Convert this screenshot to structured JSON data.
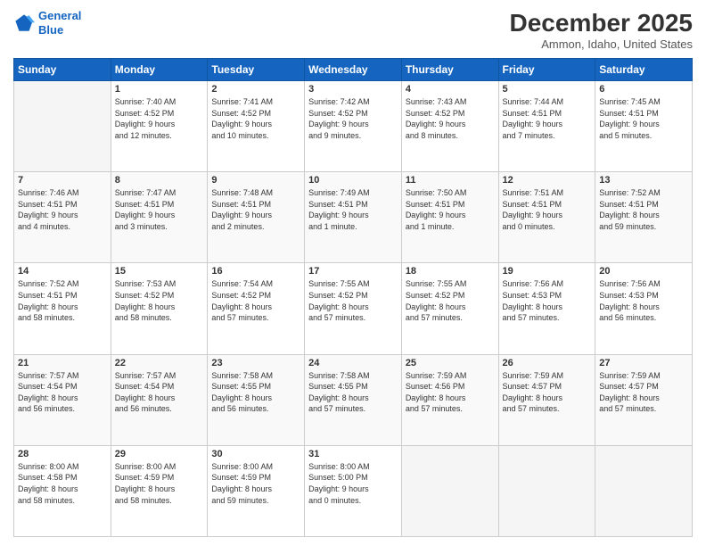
{
  "header": {
    "logo_line1": "General",
    "logo_line2": "Blue",
    "month": "December 2025",
    "location": "Ammon, Idaho, United States"
  },
  "days_of_week": [
    "Sunday",
    "Monday",
    "Tuesday",
    "Wednesday",
    "Thursday",
    "Friday",
    "Saturday"
  ],
  "weeks": [
    [
      {
        "day": "",
        "content": ""
      },
      {
        "day": "1",
        "content": "Sunrise: 7:40 AM\nSunset: 4:52 PM\nDaylight: 9 hours\nand 12 minutes."
      },
      {
        "day": "2",
        "content": "Sunrise: 7:41 AM\nSunset: 4:52 PM\nDaylight: 9 hours\nand 10 minutes."
      },
      {
        "day": "3",
        "content": "Sunrise: 7:42 AM\nSunset: 4:52 PM\nDaylight: 9 hours\nand 9 minutes."
      },
      {
        "day": "4",
        "content": "Sunrise: 7:43 AM\nSunset: 4:52 PM\nDaylight: 9 hours\nand 8 minutes."
      },
      {
        "day": "5",
        "content": "Sunrise: 7:44 AM\nSunset: 4:51 PM\nDaylight: 9 hours\nand 7 minutes."
      },
      {
        "day": "6",
        "content": "Sunrise: 7:45 AM\nSunset: 4:51 PM\nDaylight: 9 hours\nand 5 minutes."
      }
    ],
    [
      {
        "day": "7",
        "content": "Sunrise: 7:46 AM\nSunset: 4:51 PM\nDaylight: 9 hours\nand 4 minutes."
      },
      {
        "day": "8",
        "content": "Sunrise: 7:47 AM\nSunset: 4:51 PM\nDaylight: 9 hours\nand 3 minutes."
      },
      {
        "day": "9",
        "content": "Sunrise: 7:48 AM\nSunset: 4:51 PM\nDaylight: 9 hours\nand 2 minutes."
      },
      {
        "day": "10",
        "content": "Sunrise: 7:49 AM\nSunset: 4:51 PM\nDaylight: 9 hours\nand 1 minute."
      },
      {
        "day": "11",
        "content": "Sunrise: 7:50 AM\nSunset: 4:51 PM\nDaylight: 9 hours\nand 1 minute."
      },
      {
        "day": "12",
        "content": "Sunrise: 7:51 AM\nSunset: 4:51 PM\nDaylight: 9 hours\nand 0 minutes."
      },
      {
        "day": "13",
        "content": "Sunrise: 7:52 AM\nSunset: 4:51 PM\nDaylight: 8 hours\nand 59 minutes."
      }
    ],
    [
      {
        "day": "14",
        "content": "Sunrise: 7:52 AM\nSunset: 4:51 PM\nDaylight: 8 hours\nand 58 minutes."
      },
      {
        "day": "15",
        "content": "Sunrise: 7:53 AM\nSunset: 4:52 PM\nDaylight: 8 hours\nand 58 minutes."
      },
      {
        "day": "16",
        "content": "Sunrise: 7:54 AM\nSunset: 4:52 PM\nDaylight: 8 hours\nand 57 minutes."
      },
      {
        "day": "17",
        "content": "Sunrise: 7:55 AM\nSunset: 4:52 PM\nDaylight: 8 hours\nand 57 minutes."
      },
      {
        "day": "18",
        "content": "Sunrise: 7:55 AM\nSunset: 4:52 PM\nDaylight: 8 hours\nand 57 minutes."
      },
      {
        "day": "19",
        "content": "Sunrise: 7:56 AM\nSunset: 4:53 PM\nDaylight: 8 hours\nand 57 minutes."
      },
      {
        "day": "20",
        "content": "Sunrise: 7:56 AM\nSunset: 4:53 PM\nDaylight: 8 hours\nand 56 minutes."
      }
    ],
    [
      {
        "day": "21",
        "content": "Sunrise: 7:57 AM\nSunset: 4:54 PM\nDaylight: 8 hours\nand 56 minutes."
      },
      {
        "day": "22",
        "content": "Sunrise: 7:57 AM\nSunset: 4:54 PM\nDaylight: 8 hours\nand 56 minutes."
      },
      {
        "day": "23",
        "content": "Sunrise: 7:58 AM\nSunset: 4:55 PM\nDaylight: 8 hours\nand 56 minutes."
      },
      {
        "day": "24",
        "content": "Sunrise: 7:58 AM\nSunset: 4:55 PM\nDaylight: 8 hours\nand 57 minutes."
      },
      {
        "day": "25",
        "content": "Sunrise: 7:59 AM\nSunset: 4:56 PM\nDaylight: 8 hours\nand 57 minutes."
      },
      {
        "day": "26",
        "content": "Sunrise: 7:59 AM\nSunset: 4:57 PM\nDaylight: 8 hours\nand 57 minutes."
      },
      {
        "day": "27",
        "content": "Sunrise: 7:59 AM\nSunset: 4:57 PM\nDaylight: 8 hours\nand 57 minutes."
      }
    ],
    [
      {
        "day": "28",
        "content": "Sunrise: 8:00 AM\nSunset: 4:58 PM\nDaylight: 8 hours\nand 58 minutes."
      },
      {
        "day": "29",
        "content": "Sunrise: 8:00 AM\nSunset: 4:59 PM\nDaylight: 8 hours\nand 58 minutes."
      },
      {
        "day": "30",
        "content": "Sunrise: 8:00 AM\nSunset: 4:59 PM\nDaylight: 8 hours\nand 59 minutes."
      },
      {
        "day": "31",
        "content": "Sunrise: 8:00 AM\nSunset: 5:00 PM\nDaylight: 9 hours\nand 0 minutes."
      },
      {
        "day": "",
        "content": ""
      },
      {
        "day": "",
        "content": ""
      },
      {
        "day": "",
        "content": ""
      }
    ]
  ]
}
